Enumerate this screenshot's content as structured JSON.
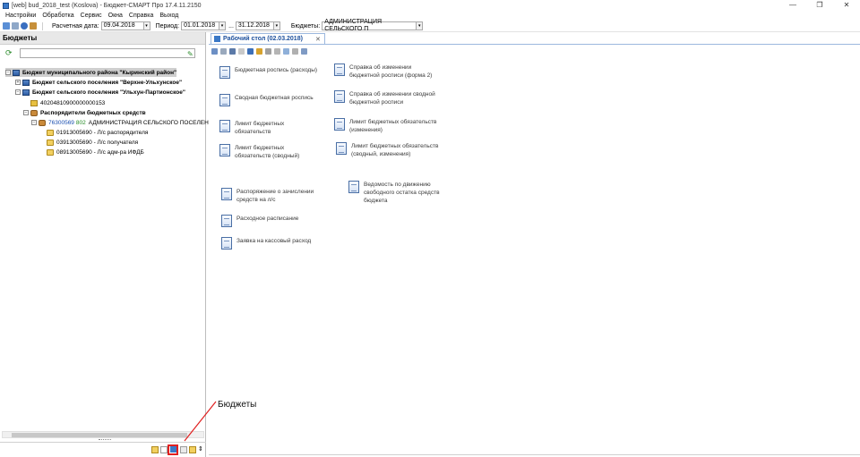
{
  "window": {
    "title": "[web] bud_2018_test (Koslova) - Бюджет-СМАРТ Про 17.4.11.2150",
    "minimize": "—",
    "maximize": "❐",
    "close": "✕"
  },
  "menu": [
    "Настройки",
    "Обработка",
    "Сервис",
    "Окна",
    "Справка",
    "Выход"
  ],
  "toolbar": {
    "calc_date_label": "Расчетная дата:",
    "calc_date_value": "09.04.2018",
    "period_label": "Период:",
    "period_from": "01.01.2018",
    "period_sep": "...",
    "period_to": "31.12.2018",
    "budgets_label": "Бюджеты:",
    "budgets_value": "АДМИНИСТРАЦИЯ СЕЛЬСКОГО П",
    "dropdown_glyph": "▾"
  },
  "left_panel": {
    "title": "Бюджеты",
    "tree": [
      {
        "text": "Бюджет муниципального района \"Кыринский район\"",
        "bold": true,
        "expander": "−",
        "icon": "budget-icon"
      },
      {
        "text": "Бюджет сельского поселения \"Верхне-Ульхунское\"",
        "bold": true,
        "expander": "+",
        "icon": "budget-icon"
      },
      {
        "text": "Бюджет сельского поселения \"Ульхун-Партионское\"",
        "bold": true,
        "expander": "−",
        "icon": "budget-icon"
      },
      {
        "text": "40204810900000000153",
        "bold": false,
        "expander": "",
        "icon": "account-icon"
      },
      {
        "text": "Распорядители бюджетных средств",
        "bold": true,
        "expander": "−",
        "icon": "people-icon"
      },
      {
        "code": "76300569",
        "code2": "802",
        "text": "АДМИНИСТРАЦИЯ СЕЛЬСКОГО ПОСЕЛЕН",
        "bold": false,
        "expander": "−",
        "icon": "people-icon"
      },
      {
        "text": "01913005690 - Л/с распорядителя",
        "bold": false,
        "expander": "",
        "icon": "money-icon"
      },
      {
        "text": "03913005690 - Л/с получателя",
        "bold": false,
        "expander": "",
        "icon": "money-icon"
      },
      {
        "text": "08913005690 - Л/с адм-ра ИФДБ",
        "bold": false,
        "expander": "",
        "icon": "money-icon"
      }
    ]
  },
  "callout": {
    "label": "Бюджеты"
  },
  "workspace": {
    "tab_title": "Рабочий стол (02.03.2018)",
    "tab_close": "✕",
    "items": [
      {
        "label": "Бюджетная роспись (расходы)"
      },
      {
        "label": "Сводная бюджетная роспись"
      },
      {
        "label": "Лимит бюджетных обязательств"
      },
      {
        "label": "Лимит бюджетных обязательств (сводный)"
      },
      {
        "label": "Справка об изменении бюджетной росписи (форма 2)"
      },
      {
        "label": "Справка об изменении сводной бюджетной росписи"
      },
      {
        "label": "Лимит бюджетных обязательств (изменения)"
      },
      {
        "label": "Лимит бюджетных обязательств (сводный, изменения)"
      },
      {
        "label": "Распоряжение о зачислении средств на л/с"
      },
      {
        "label": "Расходное расписание"
      },
      {
        "label": "Заявка на кассовый расход"
      },
      {
        "label": "Ведомость по движению свободного остатка средств бюджета"
      }
    ]
  },
  "colors": {
    "accent": "#3a78c7",
    "highlight": "#e02020",
    "tab_text": "#1c4f9c"
  }
}
